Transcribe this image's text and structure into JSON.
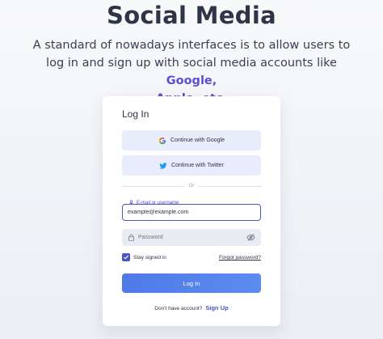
{
  "hero": {
    "title": "Social Media",
    "description_plain": "A standard of nowadays interfaces is to allow users to log in and sign up with social media accounts like ",
    "description_highlight_1": "Google,",
    "description_highlight_2": "Apple, etc."
  },
  "login_card": {
    "title": "Log In",
    "google_button": "Continue with Google",
    "twitter_button": "Continue with Twitter",
    "divider_text": "Or",
    "email_label": "E-mail or username",
    "email_value": "example@example.com",
    "password_placeholder": "Password",
    "stay_signed_in": "Stay signed in",
    "stay_signed_in_checked": true,
    "forgot_password": "Forgot password?",
    "login_button": "Log In",
    "no_account_text": "Don't have account?",
    "signup_link": "Sign Up"
  },
  "colors": {
    "accent": "#4a55c8",
    "highlight_text": "#5a4fd0",
    "social_button_bg": "#e8ecfb",
    "login_button": "#5b8cf0",
    "twitter_blue": "#1d9bf0"
  },
  "icons": {
    "google": "google-icon",
    "twitter": "twitter-icon",
    "user": "user-icon",
    "lock": "lock-icon",
    "eye_off": "eye-off-icon",
    "checkmark": "checkmark-icon"
  }
}
